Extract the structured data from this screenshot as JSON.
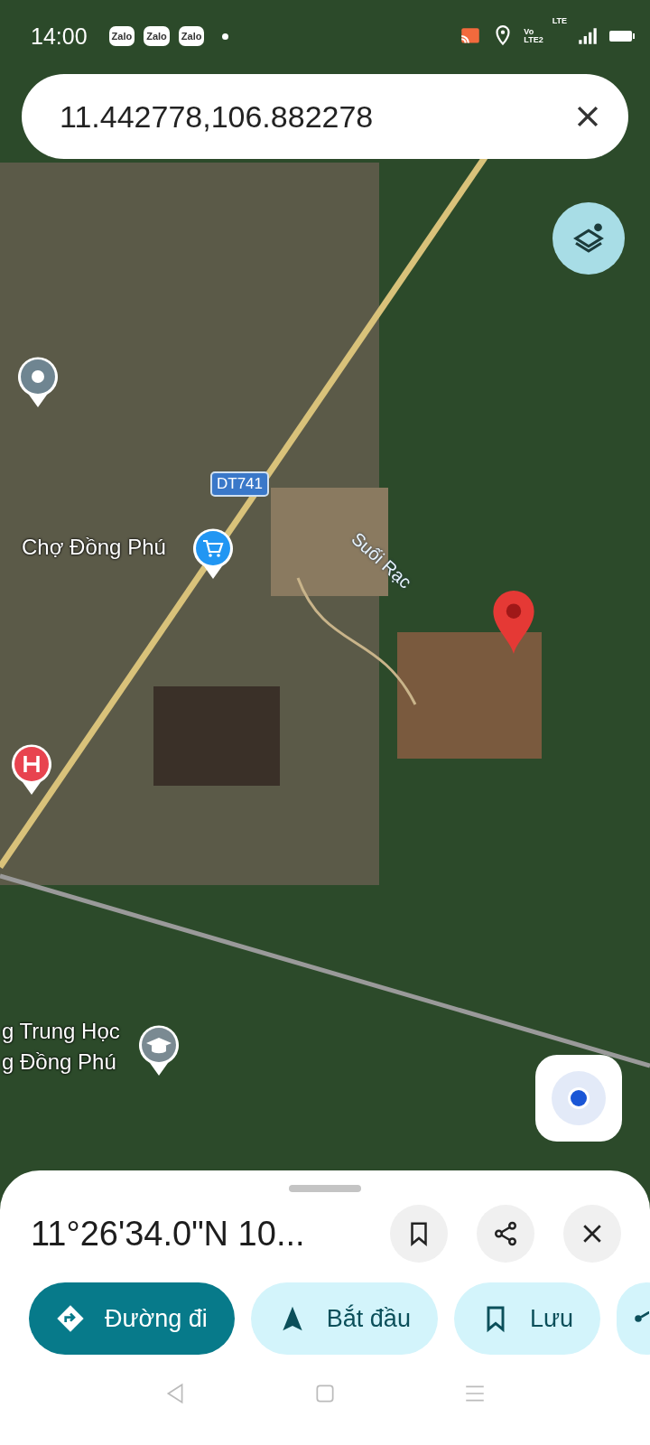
{
  "status_bar": {
    "time": "14:00",
    "app_badges": [
      "Zalo",
      "Zalo",
      "Zalo"
    ],
    "network_labels": [
      "Vo",
      "LTE2",
      "LTE"
    ]
  },
  "search": {
    "value": "11.442778,106.882278"
  },
  "map_labels": [
    {
      "text": "DT741",
      "kind": "road"
    },
    {
      "text": "Chợ Đồng Phú",
      "kind": "place"
    },
    {
      "text": "Suối Rạc",
      "kind": "water"
    },
    {
      "text": "g Trung Học",
      "kind": "place"
    },
    {
      "text": "g Đồng Phú",
      "kind": "place"
    }
  ],
  "sheet": {
    "title": "11°26'34.0\"N 10...",
    "chips": [
      {
        "label": "Đường đi",
        "kind": "directions"
      },
      {
        "label": "Bắt đầu",
        "kind": "start"
      },
      {
        "label": "Lưu",
        "kind": "save"
      },
      {
        "kind": "share"
      }
    ]
  }
}
